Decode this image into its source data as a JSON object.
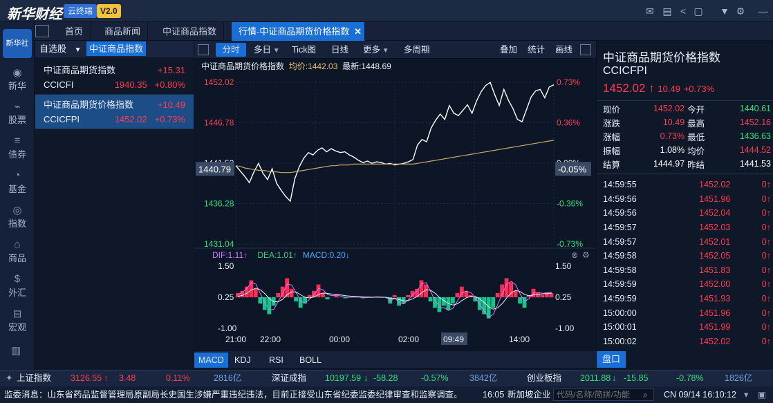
{
  "app": {
    "logo": "新华财经",
    "cloud_label": "云终端",
    "version": "V2.0"
  },
  "top_icons": [
    "mail-icon",
    "chat-icon",
    "share-icon",
    "document-icon",
    "shirt-icon",
    "gear-icon",
    "minimize-icon",
    "maximize-icon",
    "close-icon"
  ],
  "tabs": [
    {
      "label": "首页"
    },
    {
      "label": "商品新闻"
    },
    {
      "label": "中证商品指数"
    },
    {
      "label": "行情-中证商品期货价格指数",
      "active": true
    }
  ],
  "rail": [
    {
      "label": "新华",
      "icon": "news-icon"
    },
    {
      "label": "股票",
      "icon": "stock-chart-icon"
    },
    {
      "label": "债券",
      "icon": "bond-icon"
    },
    {
      "label": "基金",
      "icon": "fund-icon"
    },
    {
      "label": "指数",
      "icon": "index-icon"
    },
    {
      "label": "商品",
      "icon": "commodity-icon"
    },
    {
      "label": "外汇",
      "icon": "forex-icon"
    },
    {
      "label": "宏观",
      "icon": "macro-icon"
    }
  ],
  "rail_logo": "新华社",
  "watchlist": {
    "tab1": "自选股",
    "tab2": "中证商品指数",
    "items": [
      {
        "name": "中证商品期货指数",
        "change": "+15.31",
        "code": "CCICFI",
        "price": "1940.35",
        "pct": "+0.80%"
      },
      {
        "name": "中证商品期货价格指数",
        "change": "+10.49",
        "code": "CCICFPI",
        "price": "1452.02",
        "pct": "+0.73%"
      }
    ]
  },
  "chart_toolbar": {
    "buttons": [
      "分时",
      "多日",
      "Tick图",
      "日线",
      "更多",
      "多周期"
    ],
    "right_buttons": [
      "叠加",
      "统计",
      "画线"
    ]
  },
  "chart_info": {
    "name": "中证商品期货价格指数",
    "avg_label": "均价:1442.03",
    "last_label": "最新:1448.69"
  },
  "chart_data": [
    {
      "type": "line",
      "title": "中证商品期货价格指数",
      "ylim": [
        1431.04,
        1452.02
      ],
      "y_ticks_left": [
        "1452.02",
        "1446.78",
        "1441.53",
        "1436.28",
        "1431.04"
      ],
      "y_ticks_right": [
        "0.73%",
        "0.36%",
        "0.00%",
        "-0.36%",
        "-0.73%"
      ],
      "x_ticks": [
        "21:00",
        "22:00",
        "00:00",
        "02:00",
        "09:49",
        "14:00"
      ],
      "cursor_value": "1440.79",
      "cursor_pct": "-0.05%",
      "cursor_time": "09:49",
      "series": [
        {
          "name": "最新",
          "color": "#ffffff",
          "values": [
            1441.2,
            1440.5,
            1439.8,
            1439.0,
            1440.4,
            1441.5,
            1440.2,
            1439.4,
            1440.8,
            1438.9,
            1438.0,
            1437.2,
            1436.6,
            1439.5,
            1441.1,
            1442.2,
            1442.9,
            1442.6,
            1443.2,
            1443.5,
            1443.0,
            1443.4,
            1443.1,
            1442.9,
            1443.0,
            1442.6,
            1442.3,
            1441.9,
            1441.6,
            1441.8,
            1441.5,
            1441.7,
            1441.6,
            1441.4,
            1441.5,
            1441.3,
            1441.4,
            1441.5,
            1441.7,
            1442.0,
            1443.9,
            1444.6,
            1444.3,
            1446.1,
            1447.1,
            1447.9,
            1447.2,
            1449.0,
            1448.0,
            1447.7,
            1448.4,
            1449.1,
            1448.0,
            1449.6,
            1450.8,
            1451.6,
            1452.0,
            1450.4,
            1449.0,
            1451.1,
            1449.7,
            1448.6,
            1447.2,
            1446.9,
            1448.5,
            1450.1,
            1450.9,
            1451.1,
            1450.0,
            1451.4,
            1451.7
          ]
        },
        {
          "name": "均价",
          "color": "#c9a86a",
          "values": [
            1441.2,
            1441.1,
            1440.9,
            1440.8,
            1440.7,
            1440.6,
            1440.6,
            1440.5,
            1440.4,
            1440.4,
            1440.3,
            1440.3,
            1440.3,
            1440.4,
            1440.5,
            1440.6,
            1440.7,
            1440.8,
            1440.9,
            1441.0,
            1441.1,
            1441.2,
            1441.2,
            1441.3,
            1441.3,
            1441.3,
            1441.4,
            1441.4,
            1441.4,
            1441.4,
            1441.4,
            1441.4,
            1441.4,
            1441.4,
            1441.4,
            1441.4,
            1441.4,
            1441.4,
            1441.4,
            1441.4,
            1441.5,
            1441.6,
            1441.7,
            1441.8,
            1441.9,
            1442.0,
            1442.1,
            1442.2,
            1442.3,
            1442.4,
            1442.5,
            1442.6,
            1442.7,
            1442.8,
            1442.9,
            1443.0,
            1443.1,
            1443.2,
            1443.3,
            1443.4,
            1443.5,
            1443.6,
            1443.7,
            1443.8,
            1443.9,
            1444.0,
            1444.1,
            1444.2,
            1444.3,
            1444.4,
            1444.5
          ]
        }
      ]
    },
    {
      "type": "bar",
      "title": "MACD",
      "legend": [
        "DIF:1.11↑",
        "DEA:1.01↑",
        "MACD:0.20↓"
      ],
      "ylim": [
        -1.0,
        1.5
      ],
      "y_ticks": [
        "1.50",
        "0.25",
        "-1.00"
      ],
      "values": [
        0.2,
        0.3,
        0.5,
        0.8,
        0.4,
        -0.3,
        -0.6,
        -0.8,
        -0.4,
        0.2,
        0.5,
        0.9,
        0.4,
        -0.2,
        -0.5,
        -0.3,
        0.1,
        0.3,
        0.6,
        0.2,
        -0.1,
        0.0,
        0.1,
        0.0,
        -0.05,
        0.0,
        0.02,
        0.0,
        -0.05,
        0.0,
        0.0,
        0.03,
        -0.02,
        0.0,
        -0.3,
        0.1,
        -0.4,
        -0.3,
        0.1,
        0.3,
        0.4,
        0.8,
        0.6,
        -0.2,
        -0.5,
        -0.7,
        -0.4,
        -0.6,
        -0.3,
        0.2,
        0.5,
        0.3,
        0.1,
        -0.2,
        -0.6,
        -0.8,
        -1.0,
        -0.5,
        0.2,
        0.6,
        0.9,
        0.7,
        0.3,
        -0.3,
        -0.5,
        0.1,
        0.4,
        0.2,
        0.1,
        0.2,
        0.2
      ]
    }
  ],
  "bottom_tabs": [
    "MACD",
    "KDJ",
    "RSI",
    "BOLL"
  ],
  "quote": {
    "name": "中证商品期货价格指数",
    "code": "CCICFPI",
    "price": "1452.02",
    "change": "10.49",
    "pct": "+0.73%",
    "rows": [
      [
        "现价",
        "1452.02",
        "今开",
        "1440.61"
      ],
      [
        "涨跌",
        "10.49",
        "最高",
        "1452.16"
      ],
      [
        "涨幅",
        "0.73%",
        "最低",
        "1436.63"
      ],
      [
        "振幅",
        "1.08%",
        "均价",
        "1444.52"
      ],
      [
        "结算",
        "1444.97",
        "昨结",
        "1441.53"
      ]
    ],
    "ticks": [
      [
        "14:59:55",
        "1452.02",
        "0"
      ],
      [
        "14:59:56",
        "1451.96",
        "0"
      ],
      [
        "14:59:56",
        "1452.04",
        "0"
      ],
      [
        "14:59:57",
        "1452.03",
        "0"
      ],
      [
        "14:59:57",
        "1452.01",
        "0"
      ],
      [
        "14:59:58",
        "1452.05",
        "0"
      ],
      [
        "14:59:58",
        "1451.83",
        "0"
      ],
      [
        "14:59:59",
        "1452.00",
        "0"
      ],
      [
        "14:59:59",
        "1451.93",
        "0"
      ],
      [
        "15:00:00",
        "1451.96",
        "0"
      ],
      [
        "15:00:01",
        "1451.99",
        "0"
      ],
      [
        "15:00:02",
        "1452.02",
        "0"
      ]
    ],
    "footer_btn": "盘口"
  },
  "status": {
    "sh": {
      "name": "上证指数",
      "price": "3126.55",
      "chg": "3.48",
      "pct": "0.11%",
      "amt": "2816亿"
    },
    "sz": {
      "name": "深证成指",
      "price": "10197.59",
      "chg": "-58.28",
      "pct": "-0.57%",
      "amt": "3842亿"
    },
    "cy": {
      "name": "创业板指",
      "price": "2011.88",
      "chg": "-15.85",
      "pct": "-0.78%",
      "amt": "1826亿"
    }
  },
  "news": {
    "text": "监委消息：山东省药品监督管理局原副局长史国生涉嫌严重违纪违法，目前正接受山东省纪委监委纪律审查和监察调查。",
    "time": "16:05",
    "source": "新加坡企业",
    "search_placeholder": "代码/名称/简拼/功能",
    "clock": "CN 09/14 16:10:12"
  }
}
